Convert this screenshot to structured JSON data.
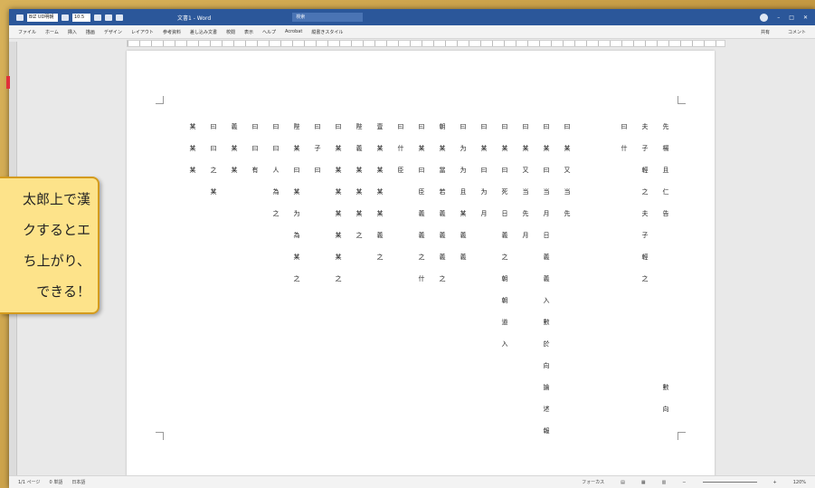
{
  "titlebar": {
    "font_combo": "BIZ UD明朝",
    "size_combo": "10.5",
    "doc_title": "文書1 - Word",
    "search_placeholder": "検索"
  },
  "menubar": {
    "items": [
      "ファイル",
      "ホーム",
      "挿入",
      "描画",
      "デザイン",
      "レイアウト",
      "参考資料",
      "差し込み文書",
      "校閲",
      "表示",
      "ヘルプ",
      "Acrobat",
      "縦書きスタイル"
    ],
    "right": [
      "共有",
      "コメント"
    ]
  },
  "statusbar": {
    "page": "1/1 ページ",
    "words": "0 単語",
    "lang": "日本語",
    "focus": "フォーカス",
    "zoom": "120%"
  },
  "callout": {
    "lines": [
      "太郎上で漢",
      "クするとエ",
      "ち上がり、",
      "できる！"
    ]
  },
  "document": {
    "columns": [
      [
        "先",
        "楊",
        "且",
        "仁",
        "告"
      ],
      [
        "夫",
        "子",
        "輕",
        "之",
        "夫",
        "子",
        "輕",
        "之"
      ],
      [
        "曰",
        "什"
      ],
      [
        "曰",
        "某",
        "又",
        "当",
        "先"
      ],
      [
        "曰",
        "某",
        "曰",
        "当",
        "月",
        "日",
        "義",
        "義",
        "入",
        "數",
        "於",
        "向",
        "論",
        "述",
        "報"
      ],
      [
        "曰",
        "某",
        "又",
        "当",
        "先",
        "月"
      ],
      [
        "曰",
        "某",
        "曰",
        "死",
        "日",
        "義",
        "之",
        "朝",
        "朝",
        "道",
        "入"
      ],
      [
        "曰",
        "某",
        "曰",
        "为",
        "月"
      ],
      [
        "曰",
        "为",
        "为",
        "且",
        "某",
        "義",
        "義"
      ],
      [
        "朝",
        "某",
        "當",
        "若",
        "義",
        "義",
        "義",
        "之"
      ],
      [
        "曰",
        "某",
        "曰",
        "臣",
        "義",
        "義",
        "之",
        "什"
      ],
      [
        "曰",
        "什",
        "臣"
      ],
      [
        "壹",
        "某",
        "某",
        "某",
        "某",
        "義",
        "之"
      ],
      [
        "陛",
        "義",
        "某",
        "某",
        "某",
        "之"
      ],
      [
        "曰",
        "某",
        "某",
        "某",
        "某",
        "某",
        "某",
        "之"
      ],
      [
        "曰",
        "子",
        "曰"
      ],
      [
        "陛",
        "某",
        "曰",
        "某",
        "为",
        "為",
        "某",
        "之"
      ],
      [
        "曰",
        "曰",
        "人",
        "為",
        "之"
      ],
      [
        "曰",
        "曰",
        "有"
      ],
      [
        "義",
        "某",
        "某"
      ],
      [
        "曰",
        "曰",
        "之",
        "某"
      ],
      [
        "某",
        "某",
        "某"
      ]
    ],
    "tail": [
      "數",
      "向"
    ]
  }
}
